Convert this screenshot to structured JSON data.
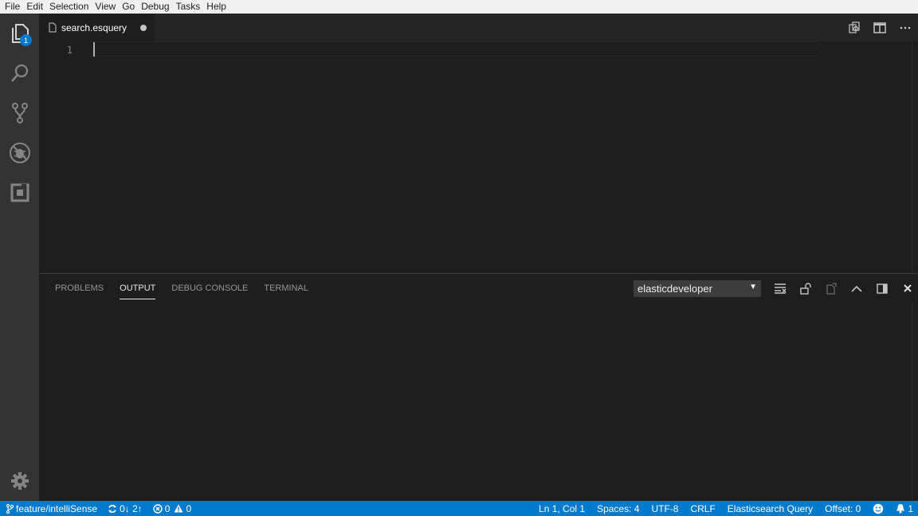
{
  "menubar": {
    "items": [
      "File",
      "Edit",
      "Selection",
      "View",
      "Go",
      "Debug",
      "Tasks",
      "Help"
    ]
  },
  "activitybar": {
    "explorer_badge": "1",
    "items": [
      "explorer-icon",
      "search-icon",
      "source-control-icon",
      "debug-icon",
      "extensions-icon",
      "gear-icon"
    ]
  },
  "tabs": [
    {
      "label": "search.esquery",
      "dirty": true
    }
  ],
  "editor": {
    "line_numbers": [
      "1"
    ],
    "content": ""
  },
  "panel": {
    "tabs": [
      "PROBLEMS",
      "OUTPUT",
      "DEBUG CONSOLE",
      "TERMINAL"
    ],
    "active_tab": "OUTPUT",
    "output_channel": "elasticdeveloper"
  },
  "statusbar": {
    "branch": "feature/intelliSense",
    "sync": "0↓ 2↑",
    "errors": "0",
    "warnings": "0",
    "cursor_position": "Ln 1, Col 1",
    "indentation": "Spaces: 4",
    "encoding": "UTF-8",
    "line_ending": "CRLF",
    "language": "Elasticsearch Query",
    "offset": "Offset: 0",
    "notifications": "1"
  },
  "colors": {
    "accent": "#007acc",
    "background": "#1e1e1e",
    "activitybar": "#333333",
    "menubar": "#f0f0f0"
  }
}
